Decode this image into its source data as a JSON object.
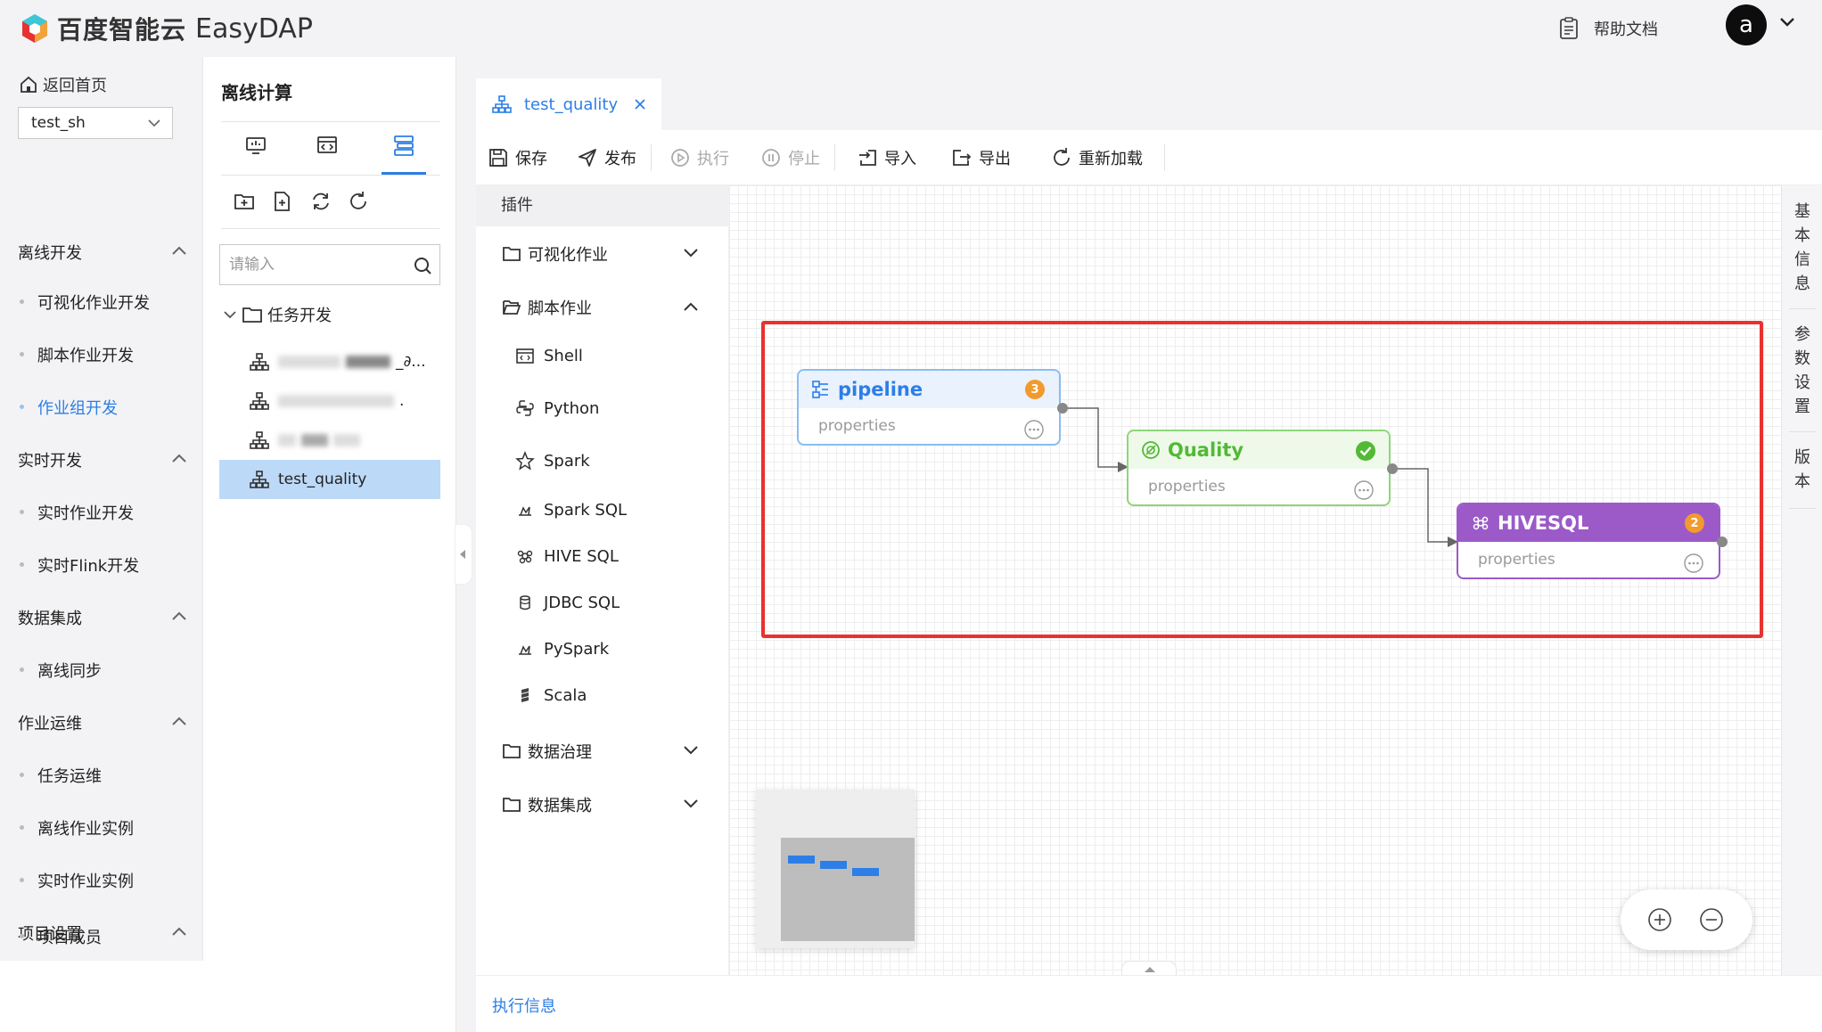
{
  "brand": {
    "name_cn": "百度智能云",
    "name_en": "EasyDAP"
  },
  "header": {
    "help_label": "帮助文档",
    "avatar_letter": "a"
  },
  "left_nav": {
    "home_label": "返回首页",
    "project": "test_sh",
    "groups": [
      {
        "label": "离线开发",
        "items": [
          {
            "label": "可视化作业开发"
          },
          {
            "label": "脚本作业开发"
          },
          {
            "label": "作业组开发",
            "active": true
          }
        ]
      },
      {
        "label": "实时开发",
        "items": [
          {
            "label": "实时作业开发"
          },
          {
            "label": "实时Flink开发"
          }
        ]
      },
      {
        "label": "数据集成",
        "items": [
          {
            "label": "离线同步"
          }
        ]
      },
      {
        "label": "作业运维",
        "items": [
          {
            "label": "任务运维"
          },
          {
            "label": "离线作业实例"
          },
          {
            "label": "实时作业实例"
          }
        ]
      },
      {
        "label": "项目设置",
        "items": [
          {
            "label": "项目成员"
          }
        ]
      }
    ]
  },
  "panel2": {
    "title": "离线计算",
    "search_placeholder": "请输入",
    "tree_root": "任务开发",
    "tree_items": [
      {
        "label": "_∂..."
      },
      {
        "label": "."
      },
      {
        "label": ""
      },
      {
        "label": "test_quality",
        "selected": true
      }
    ]
  },
  "workspace": {
    "tab_label": "test_quality",
    "toolbar": {
      "save": "保存",
      "publish": "发布",
      "run": "执行",
      "stop": "停止",
      "import": "导入",
      "export": "导出",
      "reload": "重新加载"
    },
    "plugin_header": "插件",
    "plugin_groups": {
      "visual": "可视化作业",
      "script": "脚本作业",
      "script_items": [
        "Shell",
        "Python",
        "Spark",
        "Spark SQL",
        "HIVE SQL",
        "JDBC SQL",
        "PySpark",
        "Scala"
      ],
      "governance": "数据治理",
      "integration": "数据集成"
    },
    "right_tabs": [
      "基本信息",
      "参数设置",
      "版本"
    ],
    "exec_info": "执行信息"
  },
  "nodes": [
    {
      "name": "pipeline",
      "props": "properties",
      "badge": "3",
      "color": "#2d7ee6"
    },
    {
      "name": "Quality",
      "props": "properties",
      "color": "#52b935"
    },
    {
      "name": "HIVESQL",
      "props": "properties",
      "badge": "2",
      "color": "#9b5ac8"
    }
  ],
  "colors": {
    "accent": "#2d7ee6",
    "highlight_border": "#e8322f"
  }
}
